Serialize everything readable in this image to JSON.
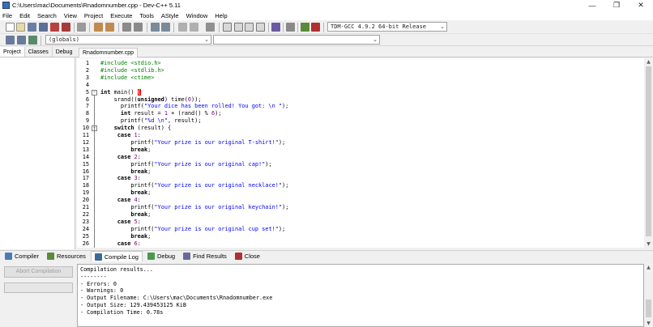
{
  "window": {
    "title": "C:\\Users\\mac\\Documents\\Rnadomnumber.cpp - Dev-C++ 5.11",
    "minimize": "—",
    "maximize": "❐",
    "close": "✕"
  },
  "menu": [
    "File",
    "Edit",
    "Search",
    "View",
    "Project",
    "Execute",
    "Tools",
    "AStyle",
    "Window",
    "Help"
  ],
  "toolbar": {
    "compiler_select": "TDM-GCC 4.9.2 64-bit Release",
    "scope_select": "(globals)",
    "scope_select2": ""
  },
  "left_panel": {
    "tabs": [
      "Project",
      "Classes",
      "Debug"
    ]
  },
  "editor": {
    "file_tab": "Rnadomnumber.cpp",
    "lines": [
      {
        "n": "1",
        "parts": [
          [
            "pre",
            "#include <stdio.h>"
          ]
        ]
      },
      {
        "n": "2",
        "parts": [
          [
            "pre",
            "#include <stdlib.h>"
          ]
        ]
      },
      {
        "n": "3",
        "parts": [
          [
            "pre",
            "#include <ctime>"
          ]
        ]
      },
      {
        "n": "4",
        "parts": []
      },
      {
        "n": "5",
        "parts": [
          [
            "kw",
            "int"
          ],
          [
            "txt",
            " main() "
          ],
          [
            "brk",
            "{"
          ]
        ]
      },
      {
        "n": "6",
        "parts": [
          [
            "txt",
            "    srand(("
          ],
          [
            "kw",
            "unsigned"
          ],
          [
            "txt",
            ") time("
          ],
          [
            "num",
            "0"
          ],
          [
            "txt",
            "));"
          ]
        ]
      },
      {
        "n": "7",
        "parts": [
          [
            "txt",
            "      printf("
          ],
          [
            "str",
            "\"Your dice has been rolled! You got: \\n \""
          ],
          [
            "txt",
            ");"
          ]
        ]
      },
      {
        "n": "8",
        "parts": [
          [
            "txt",
            "      "
          ],
          [
            "kw",
            "int"
          ],
          [
            "txt",
            " result = "
          ],
          [
            "num",
            "1"
          ],
          [
            "txt",
            " + (rand() % "
          ],
          [
            "num",
            "6"
          ],
          [
            "txt",
            ");"
          ]
        ]
      },
      {
        "n": "9",
        "parts": [
          [
            "txt",
            "      printf("
          ],
          [
            "str",
            "\"%d \\n\""
          ],
          [
            "txt",
            ", result);"
          ]
        ]
      },
      {
        "n": "10",
        "parts": [
          [
            "txt",
            "    "
          ],
          [
            "kw",
            "switch"
          ],
          [
            "txt",
            " (result) {"
          ]
        ]
      },
      {
        "n": "11",
        "parts": [
          [
            "txt",
            "     "
          ],
          [
            "kw",
            "case"
          ],
          [
            "txt",
            " "
          ],
          [
            "num",
            "1"
          ],
          [
            "txt",
            ":"
          ]
        ]
      },
      {
        "n": "12",
        "parts": [
          [
            "txt",
            "         printf("
          ],
          [
            "str",
            "\"Your prize is our original T-shirt!\""
          ],
          [
            "txt",
            ");"
          ]
        ]
      },
      {
        "n": "13",
        "parts": [
          [
            "txt",
            "         "
          ],
          [
            "kw",
            "break"
          ],
          [
            "txt",
            ";"
          ]
        ]
      },
      {
        "n": "14",
        "parts": [
          [
            "txt",
            "     "
          ],
          [
            "kw",
            "case"
          ],
          [
            "txt",
            " "
          ],
          [
            "num",
            "2"
          ],
          [
            "txt",
            ":"
          ]
        ]
      },
      {
        "n": "15",
        "parts": [
          [
            "txt",
            "         printf("
          ],
          [
            "str",
            "\"Your prize is our original cap!\""
          ],
          [
            "txt",
            ");"
          ]
        ]
      },
      {
        "n": "16",
        "parts": [
          [
            "txt",
            "         "
          ],
          [
            "kw",
            "break"
          ],
          [
            "txt",
            ";"
          ]
        ]
      },
      {
        "n": "17",
        "parts": [
          [
            "txt",
            "     "
          ],
          [
            "kw",
            "case"
          ],
          [
            "txt",
            " "
          ],
          [
            "num",
            "3"
          ],
          [
            "txt",
            ":"
          ]
        ]
      },
      {
        "n": "18",
        "parts": [
          [
            "txt",
            "         printf("
          ],
          [
            "str",
            "\"Your prize is our original necklace!\""
          ],
          [
            "txt",
            ");"
          ]
        ]
      },
      {
        "n": "19",
        "parts": [
          [
            "txt",
            "         "
          ],
          [
            "kw",
            "break"
          ],
          [
            "txt",
            ";"
          ]
        ]
      },
      {
        "n": "20",
        "parts": [
          [
            "txt",
            "     "
          ],
          [
            "kw",
            "case"
          ],
          [
            "txt",
            " "
          ],
          [
            "num",
            "4"
          ],
          [
            "txt",
            ":"
          ]
        ]
      },
      {
        "n": "21",
        "parts": [
          [
            "txt",
            "         printf("
          ],
          [
            "str",
            "\"Your prize is our original keychain!\""
          ],
          [
            "txt",
            ");"
          ]
        ]
      },
      {
        "n": "22",
        "parts": [
          [
            "txt",
            "         "
          ],
          [
            "kw",
            "break"
          ],
          [
            "txt",
            ";"
          ]
        ]
      },
      {
        "n": "23",
        "parts": [
          [
            "txt",
            "     "
          ],
          [
            "kw",
            "case"
          ],
          [
            "txt",
            " "
          ],
          [
            "num",
            "5"
          ],
          [
            "txt",
            ":"
          ]
        ]
      },
      {
        "n": "24",
        "parts": [
          [
            "txt",
            "         printf("
          ],
          [
            "str",
            "\"Your prize is our original cup set!\""
          ],
          [
            "txt",
            ");"
          ]
        ]
      },
      {
        "n": "25",
        "parts": [
          [
            "txt",
            "         "
          ],
          [
            "kw",
            "break"
          ],
          [
            "txt",
            ";"
          ]
        ]
      },
      {
        "n": "26",
        "parts": [
          [
            "txt",
            "     "
          ],
          [
            "kw",
            "case"
          ],
          [
            "txt",
            " "
          ],
          [
            "num",
            "6"
          ],
          [
            "txt",
            ":"
          ]
        ]
      }
    ]
  },
  "bottom_tabs": [
    {
      "label": "Compiler",
      "icon": "compiler-icon",
      "color": "#4a7ab5"
    },
    {
      "label": "Resources",
      "icon": "resources-icon",
      "color": "#5a8a3a"
    },
    {
      "label": "Compile Log",
      "icon": "compile-log-icon",
      "color": "#3a6a9a"
    },
    {
      "label": "Debug",
      "icon": "debug-icon",
      "color": "#4a9a4a"
    },
    {
      "label": "Find Results",
      "icon": "find-results-icon",
      "color": "#6a6a9a"
    },
    {
      "label": "Close",
      "icon": "close-icon",
      "color": "#b03030"
    }
  ],
  "bottom_panel": {
    "abort_label": "Abort Compilation",
    "log": [
      "Compilation results...",
      "--------",
      "- Errors: 0",
      "- Warnings: 0",
      "- Output Filename: C:\\Users\\mac\\Documents\\Rnadomnumber.exe",
      "- Output Size: 129.439453125 KiB",
      "- Compilation Time: 0.78s"
    ]
  }
}
